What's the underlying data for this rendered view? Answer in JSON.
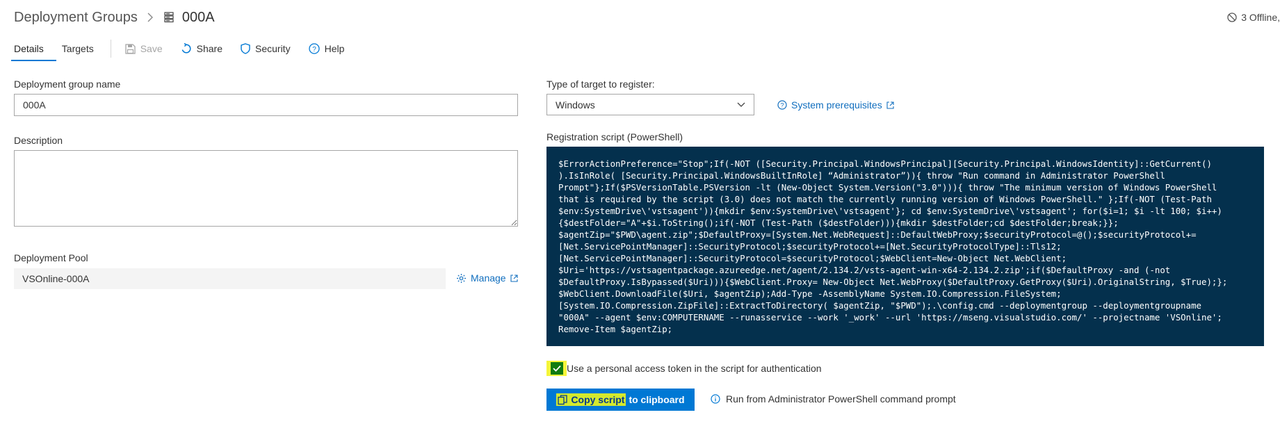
{
  "header": {
    "breadcrumb_root": "Deployment Groups",
    "current_group": "000A",
    "offline_status": "3 Offline,"
  },
  "toolbar": {
    "tabs": [
      {
        "label": "Details",
        "active": true
      },
      {
        "label": "Targets",
        "active": false
      }
    ],
    "save_label": "Save",
    "share_label": "Share",
    "security_label": "Security",
    "help_label": "Help"
  },
  "form": {
    "group_name_label": "Deployment group name",
    "group_name_value": "000A",
    "description_label": "Description",
    "description_value": "",
    "pool_label": "Deployment Pool",
    "pool_value": "VSOnline-000A",
    "manage_label": "Manage"
  },
  "registration": {
    "target_type_label": "Type of target to register:",
    "target_type_value": "Windows",
    "prereq_label": "System prerequisites",
    "script_label": "Registration script (PowerShell)",
    "script_text": "$ErrorActionPreference=\"Stop\";If(-NOT ([Security.Principal.WindowsPrincipal][Security.Principal.WindowsIdentity]::GetCurrent()\n).IsInRole( [Security.Principal.WindowsBuiltInRole] “Administrator”)){ throw \"Run command in Administrator PowerShell\nPrompt\"};If($PSVersionTable.PSVersion -lt (New-Object System.Version(\"3.0\"))){ throw \"The minimum version of Windows PowerShell\nthat is required by the script (3.0) does not match the currently running version of Windows PowerShell.\" };If(-NOT (Test-Path\n$env:SystemDrive\\'vstsagent')){mkdir $env:SystemDrive\\'vstsagent'}; cd $env:SystemDrive\\'vstsagent'; for($i=1; $i -lt 100; $i++)\n{$destFolder=\"A\"+$i.ToString();if(-NOT (Test-Path ($destFolder))){mkdir $destFolder;cd $destFolder;break;}};\n$agentZip=\"$PWD\\agent.zip\";$DefaultProxy=[System.Net.WebRequest]::DefaultWebProxy;$securityProtocol=@();$securityProtocol+=\n[Net.ServicePointManager]::SecurityProtocol;$securityProtocol+=[Net.SecurityProtocolType]::Tls12;\n[Net.ServicePointManager]::SecurityProtocol=$securityProtocol;$WebClient=New-Object Net.WebClient;\n$Uri='https://vstsagentpackage.azureedge.net/agent/2.134.2/vsts-agent-win-x64-2.134.2.zip';if($DefaultProxy -and (-not\n$DefaultProxy.IsBypassed($Uri))){$WebClient.Proxy= New-Object Net.WebProxy($DefaultProxy.GetProxy($Uri).OriginalString, $True);};\n$WebClient.DownloadFile($Uri, $agentZip);Add-Type -AssemblyName System.IO.Compression.FileSystem;\n[System.IO.Compression.ZipFile]::ExtractToDirectory( $agentZip, \"$PWD\");.\\config.cmd --deploymentgroup --deploymentgroupname\n\"000A\" --agent $env:COMPUTERNAME --runasservice --work '_work' --url 'https://mseng.visualstudio.com/' --projectname 'VSOnline';\nRemove-Item $agentZip;",
    "pat_checkbox_label": "Use a personal access token in the script for authentication",
    "pat_checked": true,
    "copy_button_highlight": "Copy script",
    "copy_button_rest": "to clipboard",
    "run_hint": "Run from Administrator PowerShell command prompt"
  },
  "colors": {
    "accent": "#0078d4",
    "script_bg": "#04304d",
    "checkbox": "#107c10",
    "highlight": "#f5f53a"
  }
}
